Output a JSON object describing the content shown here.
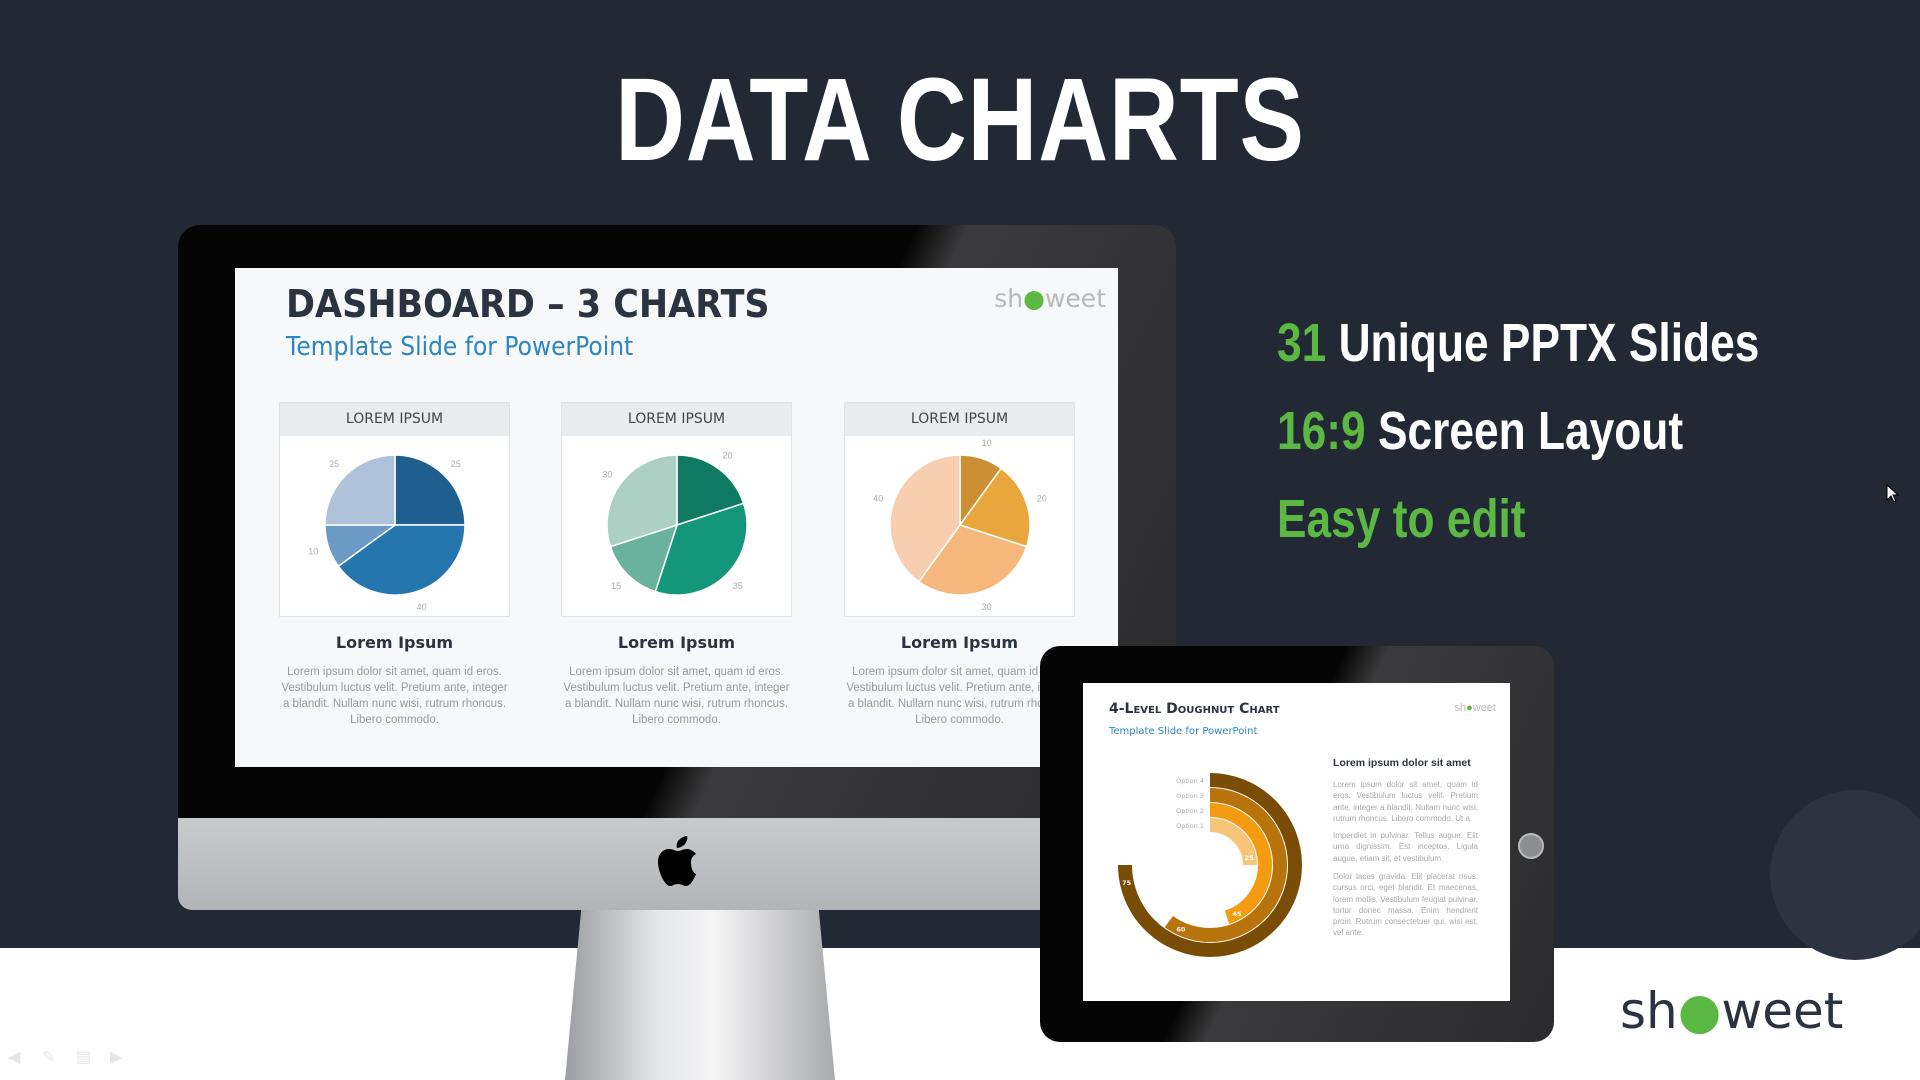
{
  "title": "DATA CHARTS",
  "features": [
    {
      "accent": "31",
      "text": "Unique PPTX Slides"
    },
    {
      "accent": "16:9",
      "text": "Screen Layout"
    },
    {
      "accent": "Easy to edit",
      "text": ""
    }
  ],
  "monitor_slide": {
    "title": "DASHBOARD – 3 CHARTS",
    "subtitle": "Template Slide for PowerPoint",
    "logo": "showeet",
    "cards": [
      {
        "header": "LOREM IPSUM",
        "title": "Lorem Ipsum",
        "text": "Lorem ipsum dolor sit amet, quam id eros. Vestibulum luctus velit. Pretium ante, integer a blandit. Nullam nunc wisi, rutrum rhoncus. Libero commodo.",
        "chart_data": {
          "type": "pie",
          "values": [
            25,
            40,
            10,
            25
          ],
          "colors": [
            "#1f5f8f",
            "#2576ae",
            "#6b9ac4",
            "#afc2d9"
          ]
        }
      },
      {
        "header": "LOREM IPSUM",
        "title": "Lorem Ipsum",
        "text": "Lorem ipsum dolor sit amet, quam id eros. Vestibulum luctus velit. Pretium ante, integer a blandit. Nullam nunc wisi, rutrum rhoncus. Libero commodo.",
        "chart_data": {
          "type": "pie",
          "values": [
            20,
            35,
            15,
            30
          ],
          "colors": [
            "#0e7a62",
            "#14967a",
            "#6ab29d",
            "#acd0c4"
          ]
        }
      },
      {
        "header": "LOREM IPSUM",
        "title": "Lorem Ipsum",
        "text": "Lorem ipsum dolor sit amet, quam id eros. Vestibulum luctus velit. Pretium ante, integer a blandit. Nullam nunc wisi, rutrum rhoncus. Libero commodo.",
        "chart_data": {
          "type": "pie",
          "values": [
            10,
            20,
            30,
            40
          ],
          "colors": [
            "#cc8f33",
            "#e9a63c",
            "#f5b77c",
            "#f7cfb0"
          ]
        }
      }
    ]
  },
  "tablet_slide": {
    "title": "4-Level Doughnut Chart",
    "subtitle": "Template Slide for PowerPoint",
    "logo": "showeet",
    "heading": "Lorem ipsum dolor sit amet",
    "paragraphs": [
      "Lorem ipsum dolor sit amet, quam id eros. Vestibulum luctus velit. Pretium ante, integer a blandit. Nullam nunc wisi, rutrum rhoncus. Libero commodo. Ut a.",
      "Imperdiet in pulvinar. Tellus augue. Elit urna dignissim. Est inceptos. Ligula augue, etiam sit, et vestibulum.",
      "Dolor lacus gravida. Elit placerat risus, cursus orci, eget blandit. Et maecenas, lorem mollis. Vestibulum feugiat pulvinar, tortor donec massa. Enim hendrerit proin. Rutrum consectetuer qui, wisi est, vel ante."
    ],
    "chart_data": {
      "type": "doughnut",
      "max": 100,
      "categories": [
        "Option 1",
        "Option 2",
        "Option 3",
        "Option 4"
      ],
      "values": [
        25,
        45,
        60,
        75
      ],
      "colors": [
        "#f8c477",
        "#f39c12",
        "#b8730c",
        "#7a4d06"
      ]
    }
  },
  "brand_logo": "showeet",
  "nav_icons": [
    "arrow-left-icon",
    "pen-icon",
    "menu-icon",
    "arrow-right-icon"
  ],
  "colors": {
    "background": "#222834",
    "accent": "#5ab843"
  }
}
